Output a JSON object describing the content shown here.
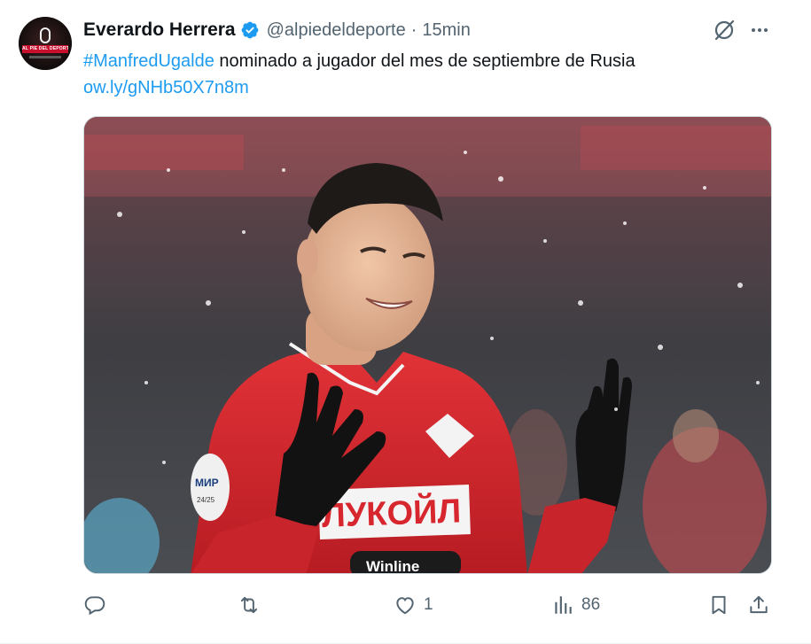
{
  "tweet": {
    "author_name": "Everardo Herrera",
    "handle": "@alpiedeldeporte",
    "separator": "·",
    "time": "15min",
    "hashtag": "#ManfredUgalde",
    "text": " nominado a jugador del mes de septiembre de Rusia",
    "link": "ow.ly/gNHb50X7n8m",
    "avatar_label": "AL PIE DEL DEPORTE",
    "shirt_text": "ЛУКОЙЛ",
    "shirt_sponsor": "Winline",
    "sleeve_badge": "МИР",
    "sleeve_badge_sub": "24/25"
  },
  "actions": {
    "replies": "",
    "reposts": "",
    "likes": "1",
    "views": "86"
  },
  "icons": {
    "verified": "verified-badge-icon",
    "grok": "grok-icon",
    "more": "more-icon",
    "reply": "reply-icon",
    "repost": "repost-icon",
    "like": "like-icon",
    "views": "views-icon",
    "bookmark": "bookmark-icon",
    "share": "share-icon"
  },
  "colors": {
    "accent": "#1d9bf0",
    "secondary_text": "#536471",
    "primary_text": "#0f1419",
    "jersey_red": "#d7262d"
  }
}
